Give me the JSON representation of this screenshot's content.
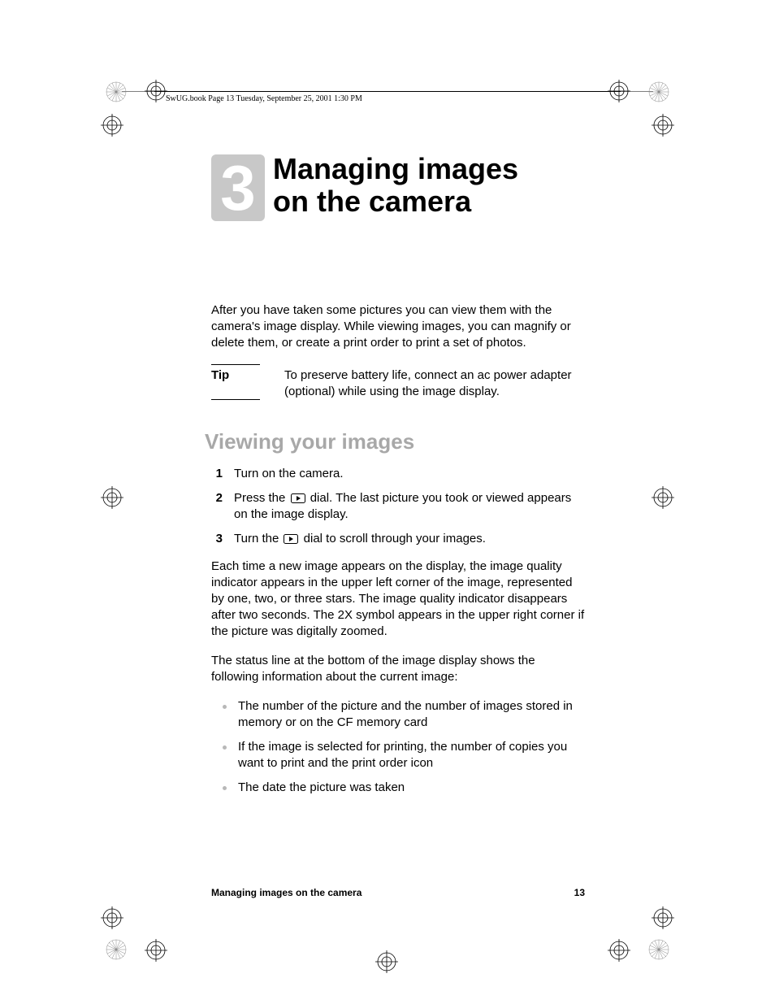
{
  "header": "SwUG.book  Page 13  Tuesday, September 25, 2001  1:30 PM",
  "chapter": {
    "number": "3",
    "title_line1": "Managing images",
    "title_line2": "on the camera"
  },
  "intro": "After you have taken some pictures you can view them with the camera's image display. While viewing images, you can magnify or delete them, or create a print order to print a set of photos.",
  "tip": {
    "label": "Tip",
    "body": "To preserve battery life, connect an ac power adapter (optional) while using the image display."
  },
  "section_title": "Viewing your images",
  "steps": [
    {
      "n": "1",
      "pre": "Turn on the camera.",
      "icon": false,
      "post": ""
    },
    {
      "n": "2",
      "pre": "Press the ",
      "icon": true,
      "post": " dial. The last picture you took or viewed appears on the image display."
    },
    {
      "n": "3",
      "pre": "Turn the ",
      "icon": true,
      "post": " dial to scroll through your images."
    }
  ],
  "para2": "Each time a new image appears on the display, the image quality indicator appears in the upper left corner of the image, represented by one, two, or three stars. The image quality indicator disappears after two seconds. The 2X symbol appears in the upper right corner if the picture was digitally zoomed.",
  "para3": "The status line at the bottom of the image display shows the following information about the current image:",
  "bullets": [
    "The number of the picture and the number of images stored in memory or on the CF memory card",
    "If the image is selected for printing, the number of copies you want to print and the print order icon",
    "The date the picture was taken"
  ],
  "footer": {
    "left": "Managing images on the camera",
    "right": "13"
  }
}
